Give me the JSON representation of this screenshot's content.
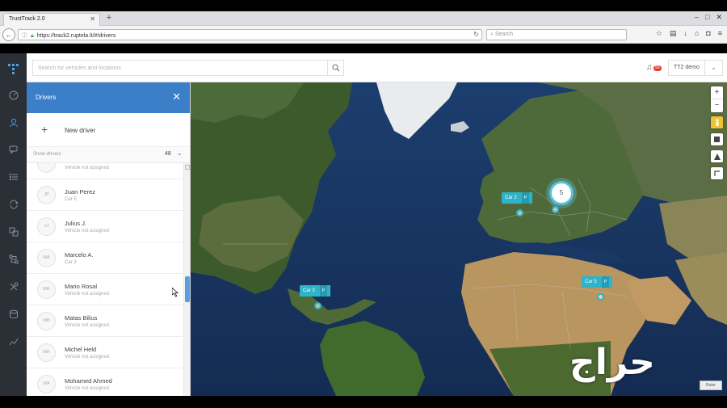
{
  "browser": {
    "tab_title": "TrustTrack 2.0",
    "url": "https://track2.ruptela.lt/#/drivers",
    "search_placeholder": "Search"
  },
  "app": {
    "search_placeholder": "Search for vehicles and locations",
    "notification_count": "99",
    "user_name": "TT2 demo"
  },
  "panel": {
    "title": "Drivers",
    "new_driver_label": "New driver",
    "show_label": "Show drivers",
    "driver_count": "48",
    "drivers": [
      {
        "initials": "",
        "name": "",
        "vehicle": "Vehicle not assigned"
      },
      {
        "initials": "JP",
        "name": "Juan Perez",
        "vehicle": "Car 5"
      },
      {
        "initials": "JJ",
        "name": "Julius J.",
        "vehicle": "Vehicle not assigned"
      },
      {
        "initials": "MA",
        "name": "Marcelo A.",
        "vehicle": "Car 3"
      },
      {
        "initials": "MR",
        "name": "Mario Rosal",
        "vehicle": "Vehicle not assigned"
      },
      {
        "initials": "MB",
        "name": "Matas Bilius",
        "vehicle": "Vehicle not assigned"
      },
      {
        "initials": "MH",
        "name": "Michel Held",
        "vehicle": "Vehicle not assigned"
      },
      {
        "initials": "MA",
        "name": "Mohamed Ahmed",
        "vehicle": "Vehicle not assigned"
      }
    ]
  },
  "map": {
    "cars": [
      {
        "label": "Car 2",
        "tag": "P"
      },
      {
        "label": "Car 3",
        "tag": "P"
      },
      {
        "label": "Car 5",
        "tag": "P"
      }
    ],
    "cluster_count": "5",
    "zoom_in": "+",
    "zoom_out": "−",
    "badge": "Ruler"
  },
  "watermark": "حراج",
  "colors": {
    "accent": "#3a7fc7",
    "rail": "#2b2f36",
    "car_marker": "#2fb3c9",
    "ocean": "#17325c"
  }
}
